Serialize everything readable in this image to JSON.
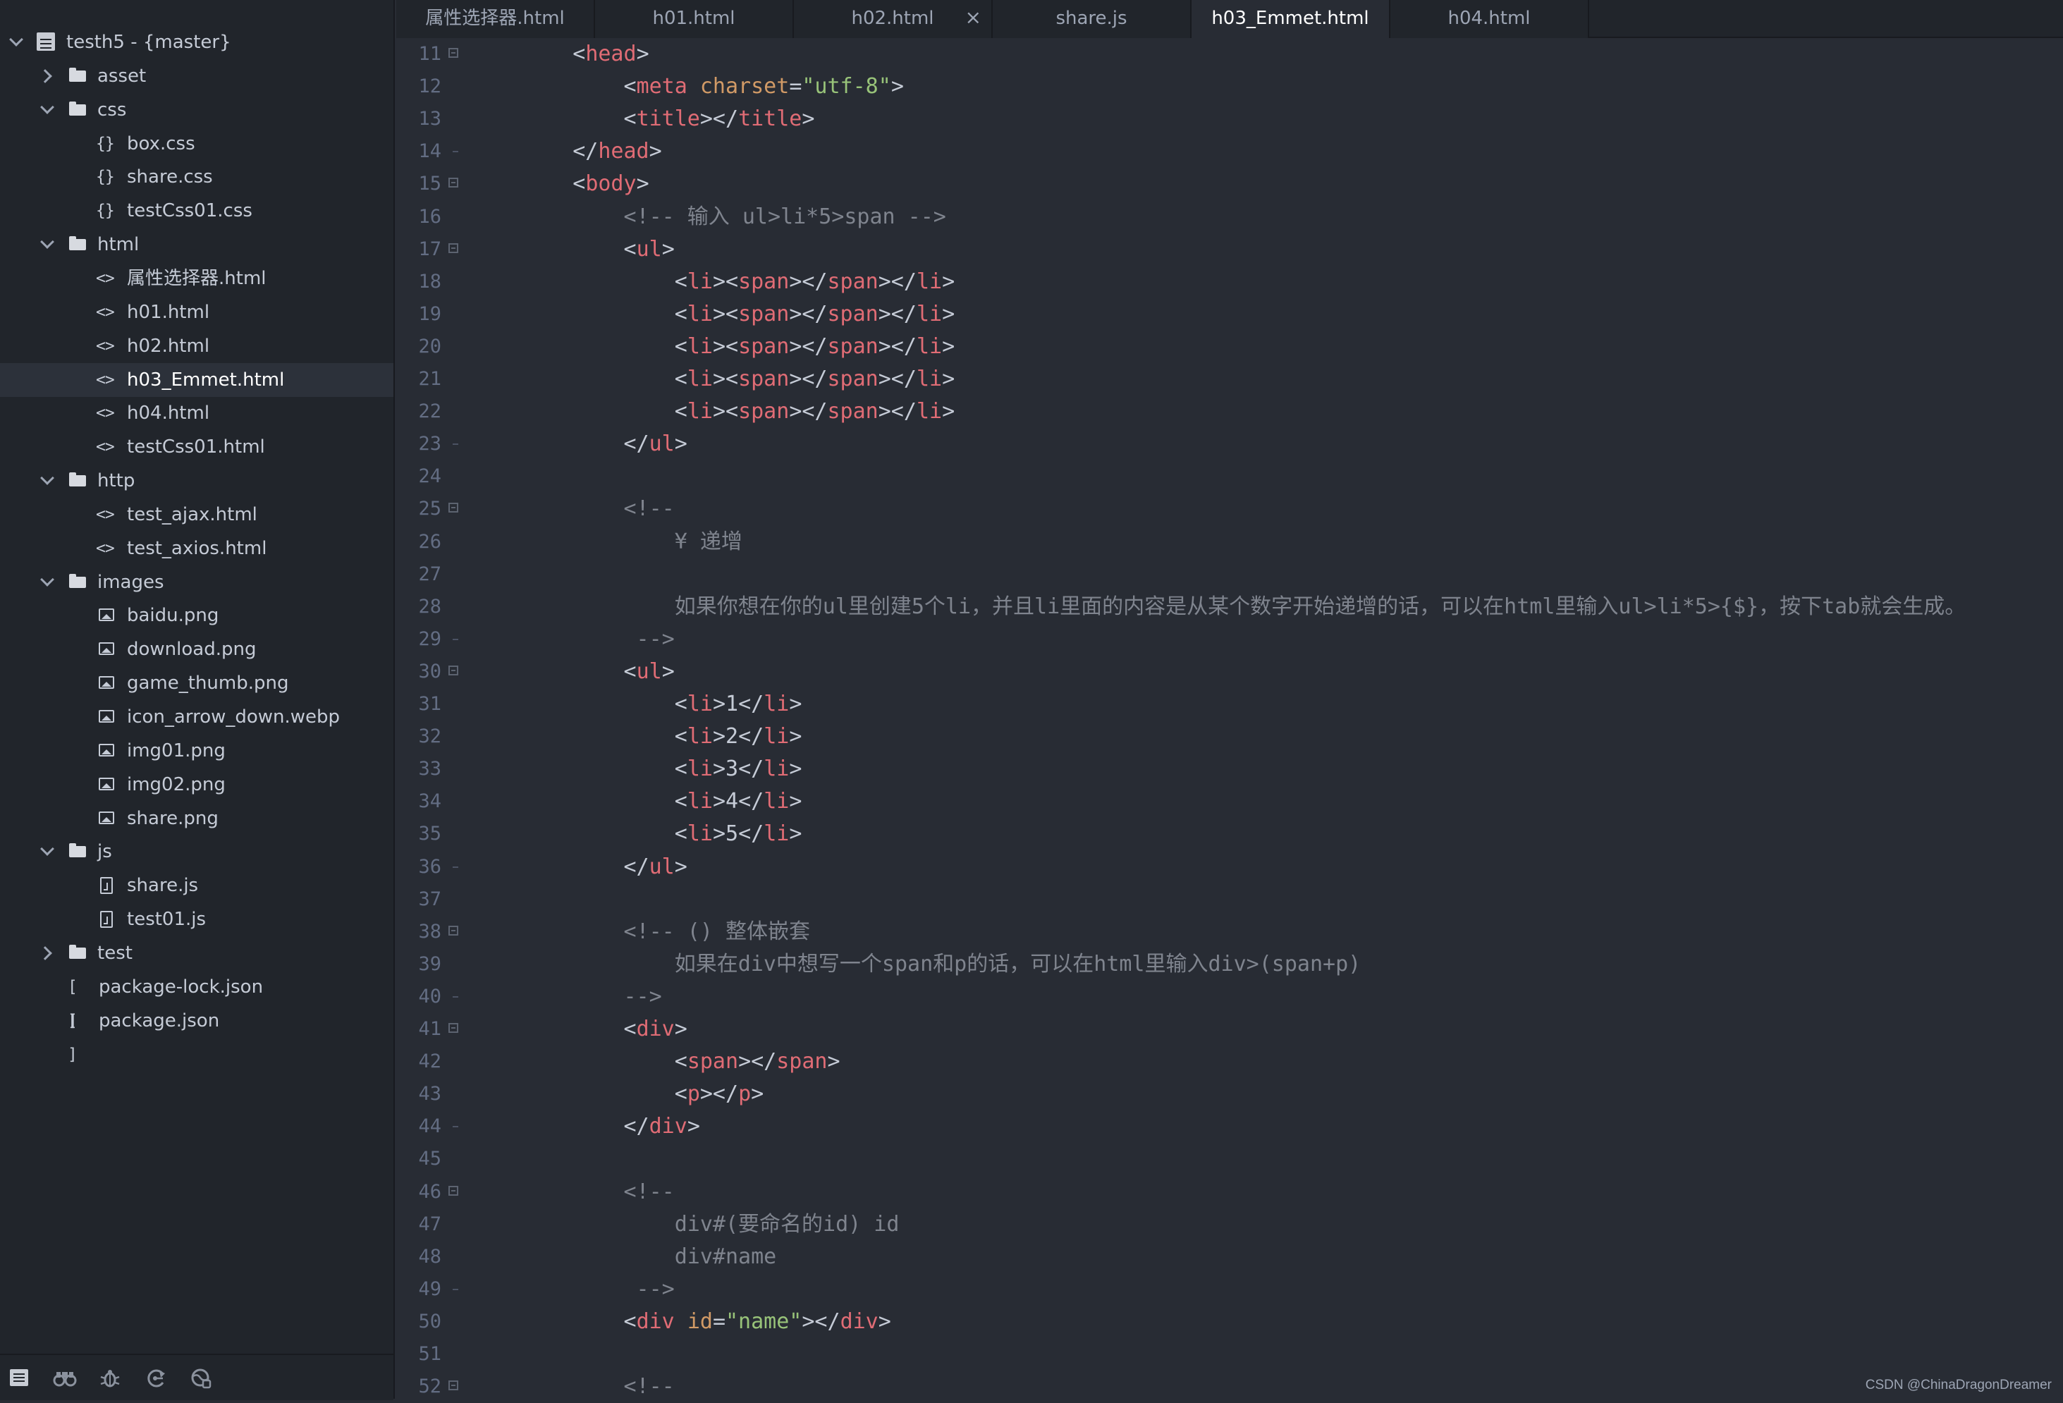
{
  "sidebar": {
    "items": [
      {
        "kind": "root",
        "chev": "open",
        "depth": 0,
        "label": "testh5 - {master}",
        "name": "project-root"
      },
      {
        "kind": "folder",
        "chev": "closed",
        "depth": 1,
        "label": "asset"
      },
      {
        "kind": "folder",
        "chev": "open",
        "depth": 1,
        "label": "css"
      },
      {
        "kind": "file",
        "icon": "{}",
        "depth": 2,
        "label": "box.css"
      },
      {
        "kind": "file",
        "icon": "{}",
        "depth": 2,
        "label": "share.css"
      },
      {
        "kind": "file",
        "icon": "{}",
        "depth": 2,
        "label": "testCss01.css"
      },
      {
        "kind": "folder",
        "chev": "open",
        "depth": 1,
        "label": "html"
      },
      {
        "kind": "file",
        "icon": "<>",
        "depth": 2,
        "label": "属性选择器.html"
      },
      {
        "kind": "file",
        "icon": "<>",
        "depth": 2,
        "label": "h01.html"
      },
      {
        "kind": "file",
        "icon": "<>",
        "depth": 2,
        "label": "h02.html"
      },
      {
        "kind": "file",
        "icon": "<>",
        "depth": 2,
        "label": "h03_Emmet.html",
        "selected": true
      },
      {
        "kind": "file",
        "icon": "<>",
        "depth": 2,
        "label": "h04.html"
      },
      {
        "kind": "file",
        "icon": "<>",
        "depth": 2,
        "label": "testCss01.html"
      },
      {
        "kind": "folder",
        "chev": "open",
        "depth": 1,
        "label": "http"
      },
      {
        "kind": "file",
        "icon": "<>",
        "depth": 2,
        "label": "test_ajax.html"
      },
      {
        "kind": "file",
        "icon": "<>",
        "depth": 2,
        "label": "test_axios.html"
      },
      {
        "kind": "folder",
        "chev": "open",
        "depth": 1,
        "label": "images"
      },
      {
        "kind": "file",
        "icon": "image",
        "depth": 2,
        "label": "baidu.png"
      },
      {
        "kind": "file",
        "icon": "image",
        "depth": 2,
        "label": "download.png"
      },
      {
        "kind": "file",
        "icon": "image",
        "depth": 2,
        "label": "game_thumb.png"
      },
      {
        "kind": "file",
        "icon": "image",
        "depth": 2,
        "label": "icon_arrow_down.webp"
      },
      {
        "kind": "file",
        "icon": "image",
        "depth": 2,
        "label": "img01.png"
      },
      {
        "kind": "file",
        "icon": "image",
        "depth": 2,
        "label": "img02.png"
      },
      {
        "kind": "file",
        "icon": "image",
        "depth": 2,
        "label": "share.png"
      },
      {
        "kind": "folder",
        "chev": "open",
        "depth": 1,
        "label": "js"
      },
      {
        "kind": "file",
        "icon": "js",
        "depth": 2,
        "label": "share.js"
      },
      {
        "kind": "file",
        "icon": "js",
        "depth": 2,
        "label": "test01.js"
      },
      {
        "kind": "folder",
        "chev": "closed",
        "depth": 1,
        "label": "test"
      },
      {
        "kind": "file",
        "icon": "[ ]",
        "depth": 1,
        "label": "package-lock.json"
      },
      {
        "kind": "file",
        "icon": "[ ]",
        "depth": 1,
        "label": "package.json"
      }
    ],
    "toolbar": [
      {
        "name": "files-icon",
        "active": true
      },
      {
        "name": "search-binoculars-icon",
        "active": false
      },
      {
        "name": "debug-bug-icon",
        "active": false
      },
      {
        "name": "source-control-icon",
        "active": false
      },
      {
        "name": "extensions-icon",
        "active": false
      }
    ]
  },
  "tabs": [
    {
      "label": "属性选择器.html",
      "active": false,
      "close": ""
    },
    {
      "label": "h01.html",
      "active": false,
      "close": ""
    },
    {
      "label": "h02.html",
      "active": false,
      "close": "×"
    },
    {
      "label": "share.js",
      "active": false,
      "close": ""
    },
    {
      "label": "h03_Emmet.html",
      "active": true,
      "close": ""
    },
    {
      "label": "h04.html",
      "active": false,
      "close": ""
    }
  ],
  "editor": {
    "lines": [
      {
        "n": "11",
        "fold": "start",
        "tokens": [
          [
            "p",
            "    <"
          ],
          [
            "tag",
            "head"
          ],
          [
            "p",
            ">"
          ]
        ]
      },
      {
        "n": "12",
        "tokens": [
          [
            "p",
            "        <"
          ],
          [
            "tag",
            "meta"
          ],
          [
            "p",
            " "
          ],
          [
            "attr",
            "charset"
          ],
          [
            "p",
            "="
          ],
          [
            "str",
            "\"utf-8\""
          ],
          [
            "p",
            ">"
          ]
        ]
      },
      {
        "n": "13",
        "tokens": [
          [
            "p",
            "        <"
          ],
          [
            "tag",
            "title"
          ],
          [
            "p",
            "></"
          ],
          [
            "tag",
            "title"
          ],
          [
            "p",
            ">"
          ]
        ]
      },
      {
        "n": "14",
        "fold": "end",
        "tokens": [
          [
            "p",
            "    </"
          ],
          [
            "tag",
            "head"
          ],
          [
            "p",
            ">"
          ]
        ]
      },
      {
        "n": "15",
        "fold": "start",
        "tokens": [
          [
            "p",
            "    <"
          ],
          [
            "tag",
            "body"
          ],
          [
            "p",
            ">"
          ]
        ]
      },
      {
        "n": "16",
        "tokens": [
          [
            "cm",
            "        <!-- 输入 ul>li*5>span -->"
          ]
        ]
      },
      {
        "n": "17",
        "fold": "start",
        "tokens": [
          [
            "p",
            "        <"
          ],
          [
            "tag",
            "ul"
          ],
          [
            "p",
            ">"
          ]
        ]
      },
      {
        "n": "18",
        "tokens": [
          [
            "p",
            "            <"
          ],
          [
            "tag",
            "li"
          ],
          [
            "p",
            "><"
          ],
          [
            "tag",
            "span"
          ],
          [
            "p",
            "></"
          ],
          [
            "tag",
            "span"
          ],
          [
            "p",
            "></"
          ],
          [
            "tag",
            "li"
          ],
          [
            "p",
            ">"
          ]
        ]
      },
      {
        "n": "19",
        "tokens": [
          [
            "p",
            "            <"
          ],
          [
            "tag",
            "li"
          ],
          [
            "p",
            "><"
          ],
          [
            "tag",
            "span"
          ],
          [
            "p",
            "></"
          ],
          [
            "tag",
            "span"
          ],
          [
            "p",
            "></"
          ],
          [
            "tag",
            "li"
          ],
          [
            "p",
            ">"
          ]
        ]
      },
      {
        "n": "20",
        "tokens": [
          [
            "p",
            "            <"
          ],
          [
            "tag",
            "li"
          ],
          [
            "p",
            "><"
          ],
          [
            "tag",
            "span"
          ],
          [
            "p",
            "></"
          ],
          [
            "tag",
            "span"
          ],
          [
            "p",
            "></"
          ],
          [
            "tag",
            "li"
          ],
          [
            "p",
            ">"
          ]
        ]
      },
      {
        "n": "21",
        "tokens": [
          [
            "p",
            "            <"
          ],
          [
            "tag",
            "li"
          ],
          [
            "p",
            "><"
          ],
          [
            "tag",
            "span"
          ],
          [
            "p",
            "></"
          ],
          [
            "tag",
            "span"
          ],
          [
            "p",
            "></"
          ],
          [
            "tag",
            "li"
          ],
          [
            "p",
            ">"
          ]
        ]
      },
      {
        "n": "22",
        "tokens": [
          [
            "p",
            "            <"
          ],
          [
            "tag",
            "li"
          ],
          [
            "p",
            "><"
          ],
          [
            "tag",
            "span"
          ],
          [
            "p",
            "></"
          ],
          [
            "tag",
            "span"
          ],
          [
            "p",
            "></"
          ],
          [
            "tag",
            "li"
          ],
          [
            "p",
            ">"
          ]
        ]
      },
      {
        "n": "23",
        "fold": "end",
        "tokens": [
          [
            "p",
            "        </"
          ],
          [
            "tag",
            "ul"
          ],
          [
            "p",
            ">"
          ]
        ]
      },
      {
        "n": "24",
        "tokens": []
      },
      {
        "n": "25",
        "fold": "start",
        "tokens": [
          [
            "cm",
            "        <!--"
          ]
        ]
      },
      {
        "n": "26",
        "tokens": [
          [
            "cm",
            "            ¥ 递增"
          ]
        ]
      },
      {
        "n": "27",
        "tokens": []
      },
      {
        "n": "28",
        "tokens": [
          [
            "cm",
            "            如果你想在你的ul里创建5个li，并且li里面的内容是从某个数字开始递增的话，可以在html里输入ul>li*5>{$}，按下tab就会生成。"
          ]
        ]
      },
      {
        "n": "29",
        "fold": "end",
        "tokens": [
          [
            "cm",
            "         -->"
          ]
        ]
      },
      {
        "n": "30",
        "fold": "start",
        "tokens": [
          [
            "p",
            "        <"
          ],
          [
            "tag",
            "ul"
          ],
          [
            "p",
            ">"
          ]
        ]
      },
      {
        "n": "31",
        "tokens": [
          [
            "p",
            "            <"
          ],
          [
            "tag",
            "li"
          ],
          [
            "p",
            ">"
          ],
          [
            "text",
            "1"
          ],
          [
            "p",
            "</"
          ],
          [
            "tag",
            "li"
          ],
          [
            "p",
            ">"
          ]
        ]
      },
      {
        "n": "32",
        "tokens": [
          [
            "p",
            "            <"
          ],
          [
            "tag",
            "li"
          ],
          [
            "p",
            ">"
          ],
          [
            "text",
            "2"
          ],
          [
            "p",
            "</"
          ],
          [
            "tag",
            "li"
          ],
          [
            "p",
            ">"
          ]
        ]
      },
      {
        "n": "33",
        "tokens": [
          [
            "p",
            "            <"
          ],
          [
            "tag",
            "li"
          ],
          [
            "p",
            ">"
          ],
          [
            "text",
            "3"
          ],
          [
            "p",
            "</"
          ],
          [
            "tag",
            "li"
          ],
          [
            "p",
            ">"
          ]
        ]
      },
      {
        "n": "34",
        "tokens": [
          [
            "p",
            "            <"
          ],
          [
            "tag",
            "li"
          ],
          [
            "p",
            ">"
          ],
          [
            "text",
            "4"
          ],
          [
            "p",
            "</"
          ],
          [
            "tag",
            "li"
          ],
          [
            "p",
            ">"
          ]
        ]
      },
      {
        "n": "35",
        "tokens": [
          [
            "p",
            "            <"
          ],
          [
            "tag",
            "li"
          ],
          [
            "p",
            ">"
          ],
          [
            "text",
            "5"
          ],
          [
            "p",
            "</"
          ],
          [
            "tag",
            "li"
          ],
          [
            "p",
            ">"
          ]
        ]
      },
      {
        "n": "36",
        "fold": "end",
        "tokens": [
          [
            "p",
            "        </"
          ],
          [
            "tag",
            "ul"
          ],
          [
            "p",
            ">"
          ]
        ]
      },
      {
        "n": "37",
        "tokens": []
      },
      {
        "n": "38",
        "fold": "start",
        "tokens": [
          [
            "cm",
            "        <!-- () 整体嵌套"
          ]
        ]
      },
      {
        "n": "39",
        "tokens": [
          [
            "cm",
            "            如果在div中想写一个span和p的话，可以在html里输入div>(span+p)"
          ]
        ]
      },
      {
        "n": "40",
        "fold": "end",
        "tokens": [
          [
            "cm",
            "        -->"
          ]
        ]
      },
      {
        "n": "41",
        "fold": "start",
        "tokens": [
          [
            "p",
            "        <"
          ],
          [
            "tag",
            "div"
          ],
          [
            "p",
            ">"
          ]
        ]
      },
      {
        "n": "42",
        "tokens": [
          [
            "p",
            "            <"
          ],
          [
            "tag",
            "span"
          ],
          [
            "p",
            "></"
          ],
          [
            "tag",
            "span"
          ],
          [
            "p",
            ">"
          ]
        ]
      },
      {
        "n": "43",
        "tokens": [
          [
            "p",
            "            <"
          ],
          [
            "tag",
            "p"
          ],
          [
            "p",
            "></"
          ],
          [
            "tag",
            "p"
          ],
          [
            "p",
            ">"
          ]
        ]
      },
      {
        "n": "44",
        "fold": "end",
        "tokens": [
          [
            "p",
            "        </"
          ],
          [
            "tag",
            "div"
          ],
          [
            "p",
            ">"
          ]
        ]
      },
      {
        "n": "45",
        "tokens": []
      },
      {
        "n": "46",
        "fold": "start",
        "tokens": [
          [
            "cm",
            "        <!--"
          ]
        ]
      },
      {
        "n": "47",
        "tokens": [
          [
            "cm",
            "            div#(要命名的id) id"
          ]
        ]
      },
      {
        "n": "48",
        "tokens": [
          [
            "cm",
            "            div#name"
          ]
        ]
      },
      {
        "n": "49",
        "fold": "end",
        "tokens": [
          [
            "cm",
            "         -->"
          ]
        ]
      },
      {
        "n": "50",
        "tokens": [
          [
            "p",
            "        <"
          ],
          [
            "tag",
            "div"
          ],
          [
            "p",
            " "
          ],
          [
            "attr",
            "id"
          ],
          [
            "p",
            "="
          ],
          [
            "str",
            "\"name\""
          ],
          [
            "p",
            "></"
          ],
          [
            "tag",
            "div"
          ],
          [
            "p",
            ">"
          ]
        ]
      },
      {
        "n": "51",
        "tokens": []
      },
      {
        "n": "52",
        "fold": "start",
        "tokens": [
          [
            "cm",
            "        <!--"
          ]
        ]
      }
    ]
  },
  "watermark": "CSDN @ChinaDragonDreamer"
}
